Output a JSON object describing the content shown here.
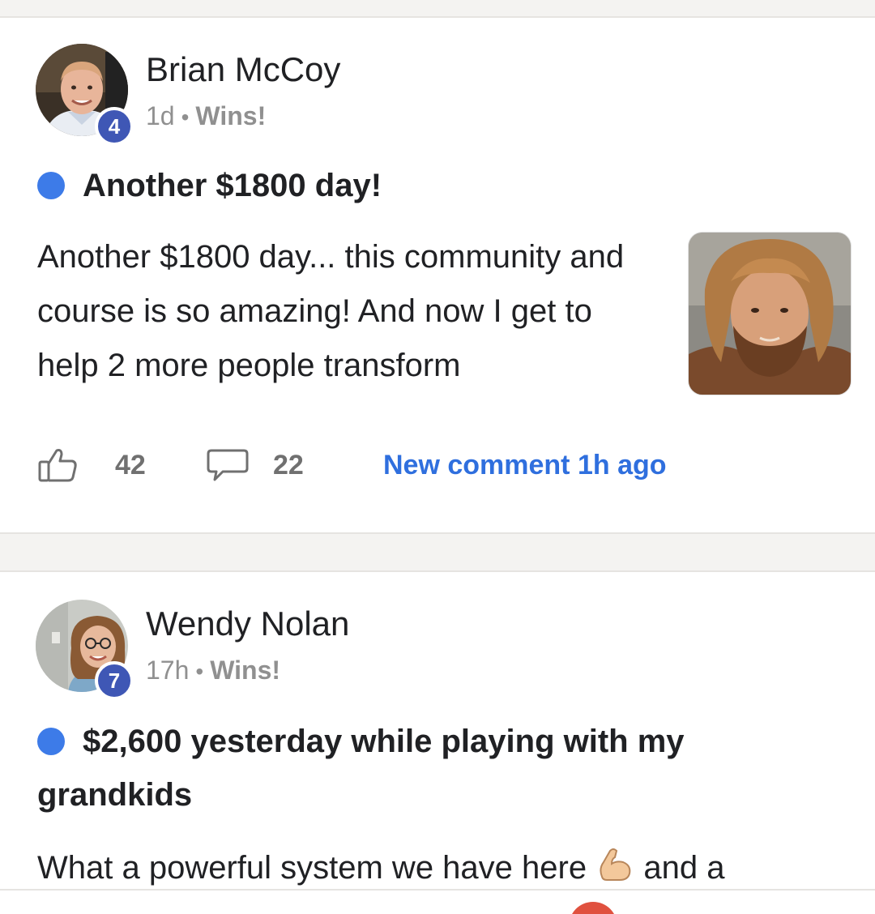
{
  "posts": [
    {
      "author": "Brian McCoy",
      "level": "4",
      "time": "1d",
      "separator": "•",
      "category": "Wins!",
      "title": "Another $1800 day!",
      "body": "Another $1800 day... this community and course is so amazing! And now I get to help 2 more people transform",
      "likes": "42",
      "comments": "22",
      "new_comment": "New comment 1h ago"
    },
    {
      "author": "Wendy Nolan",
      "level": "7",
      "time": "17h",
      "separator": "•",
      "category": "Wins!",
      "title": "$2,600 yesterday while playing with my grandkids",
      "body_start": "What a powerful system we have here",
      "body_emoji": "flexed-biceps-emoji",
      "body_end": "and a"
    }
  ],
  "colors": {
    "unread_dot": "#3d7be8",
    "level_badge": "#3f57b5",
    "link": "#2f6fde",
    "meta": "#909090"
  }
}
